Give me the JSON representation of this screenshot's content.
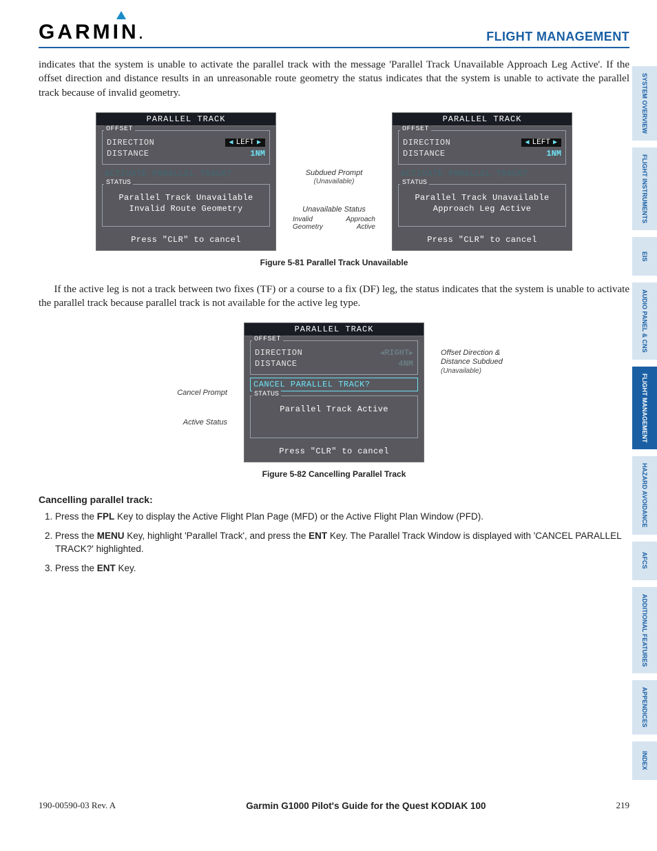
{
  "header": {
    "brand": "GARMIN",
    "section_title": "FLIGHT MANAGEMENT"
  },
  "paragraphs": {
    "p1": "indicates that the system is unable to activate the parallel track with the message 'Parallel Track Unavailable Approach Leg Active'.  If the offset direction and distance results in an unreasonable route geometry the status indicates that the system is unable to activate the parallel track because of invalid geometry.",
    "p2": "If the active leg is not a track between two fixes (TF) or a course to a fix (DF) leg, the status indicates that the system is unable to activate the parallel track because parallel track is not available for the active leg type."
  },
  "figure81": {
    "caption": "Figure 5-81  Parallel Track Unavailable",
    "panel_left": {
      "title": "PARALLEL TRACK",
      "group_label": "OFFSET",
      "direction_label": "DIRECTION",
      "direction_value": "LEFT",
      "distance_label": "DISTANCE",
      "distance_value": "1NM",
      "prompt": "ACTIVATE PARALLEL TRACK?",
      "status_label": "STATUS",
      "status_line1": "Parallel Track Unavailable",
      "status_line2": "Invalid Route Geometry",
      "footer": "Press \"CLR\" to cancel"
    },
    "panel_right": {
      "title": "PARALLEL TRACK",
      "group_label": "OFFSET",
      "direction_label": "DIRECTION",
      "direction_value": "LEFT",
      "distance_label": "DISTANCE",
      "distance_value": "1NM",
      "prompt": "ACTIVATE PARALLEL TRACK?",
      "status_label": "STATUS",
      "status_line1": "Parallel Track Unavailable",
      "status_line2": "Approach Leg Active",
      "footer": "Press \"CLR\" to cancel"
    },
    "annot": {
      "subdued_prompt": "Subdued Prompt",
      "subdued_prompt_note": "(Unavailable)",
      "unavailable_status": "Unavailable Status",
      "invalid_geometry": "Invalid\nGeometry",
      "approach_active": "Approach\nActive"
    }
  },
  "figure82": {
    "caption": "Figure 5-82  Cancelling Parallel Track",
    "panel": {
      "title": "PARALLEL TRACK",
      "group_label": "OFFSET",
      "direction_label": "DIRECTION",
      "direction_value": "RIGHT",
      "distance_label": "DISTANCE",
      "distance_value": "4NM",
      "prompt": "CANCEL PARALLEL TRACK?",
      "status_label": "STATUS",
      "status_line1": "Parallel Track Active",
      "footer": "Press \"CLR\" to cancel"
    },
    "annot": {
      "offset_subdued": "Offset Direction & Distance Subdued",
      "offset_subdued_note": "(Unavailable)",
      "cancel_prompt": "Cancel Prompt",
      "active_status": "Active Status"
    }
  },
  "procedure": {
    "heading": "Cancelling parallel track:",
    "steps": [
      "Press the FPL Key to display the Active Flight Plan Page (MFD) or the Active Flight Plan Window (PFD).",
      "Press the MENU Key, highlight 'Parallel Track', and press the ENT Key.  The Parallel Track Window is displayed with 'CANCEL PARALLEL TRACK?' highlighted.",
      "Press the ENT Key."
    ]
  },
  "tabs": [
    "SYSTEM OVERVIEW",
    "FLIGHT INSTRUMENTS",
    "EIS",
    "AUDIO PANEL & CNS",
    "FLIGHT MANAGEMENT",
    "HAZARD AVOIDANCE",
    "AFCS",
    "ADDITIONAL FEATURES",
    "APPENDICES",
    "INDEX"
  ],
  "active_tab_index": 4,
  "footer": {
    "left": "190-00590-03  Rev. A",
    "center": "Garmin G1000 Pilot's Guide for the Quest KODIAK 100",
    "right": "219"
  }
}
